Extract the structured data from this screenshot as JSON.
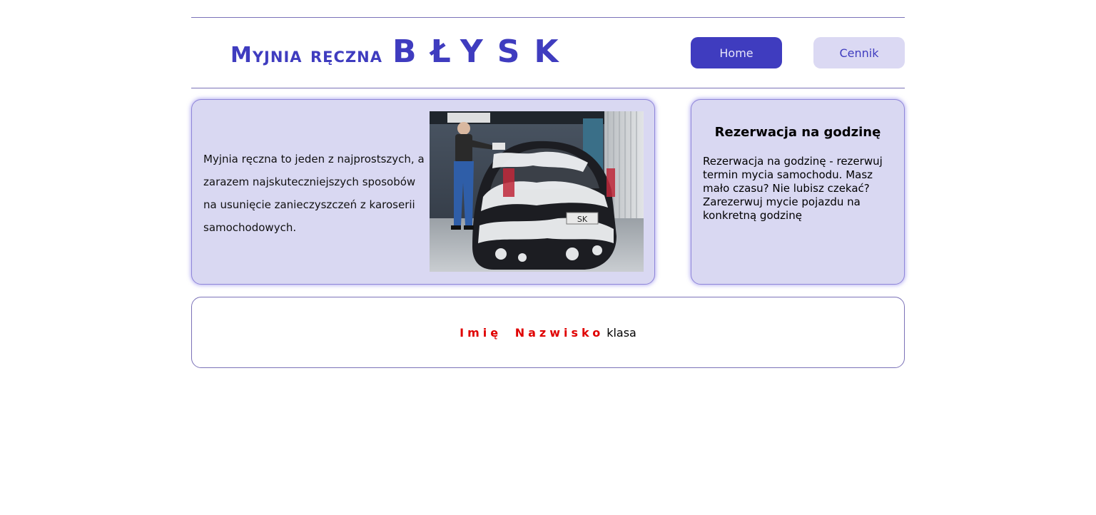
{
  "header": {
    "logo_text": "Myjnia ręczna",
    "logo_brand": "BŁYSK"
  },
  "nav": {
    "home_label": "Home",
    "cennik_label": "Cennik"
  },
  "main": {
    "paragraph": "Myjnia ręczna to jeden z najprostszych, a zarazem najskuteczniejszych sposobów na usunięcie zanieczyszczeń z karoserii samochodowych.",
    "photo_plate_text": "SK"
  },
  "side": {
    "title": "Rezerwacja na godzinę",
    "text": "Rezerwacja na godzinę - rezerwuj termin mycia samochodu. Masz mało czasu? Nie lubisz czekać? Zarezerwuj mycie pojazdu na konkretną godzinę"
  },
  "footer": {
    "author": "Imię Nazwisko",
    "class_label": "klasa"
  },
  "colors": {
    "accent": "#3f3cbf",
    "card_bg": "#d9d8f2",
    "author_red": "#e00000"
  }
}
